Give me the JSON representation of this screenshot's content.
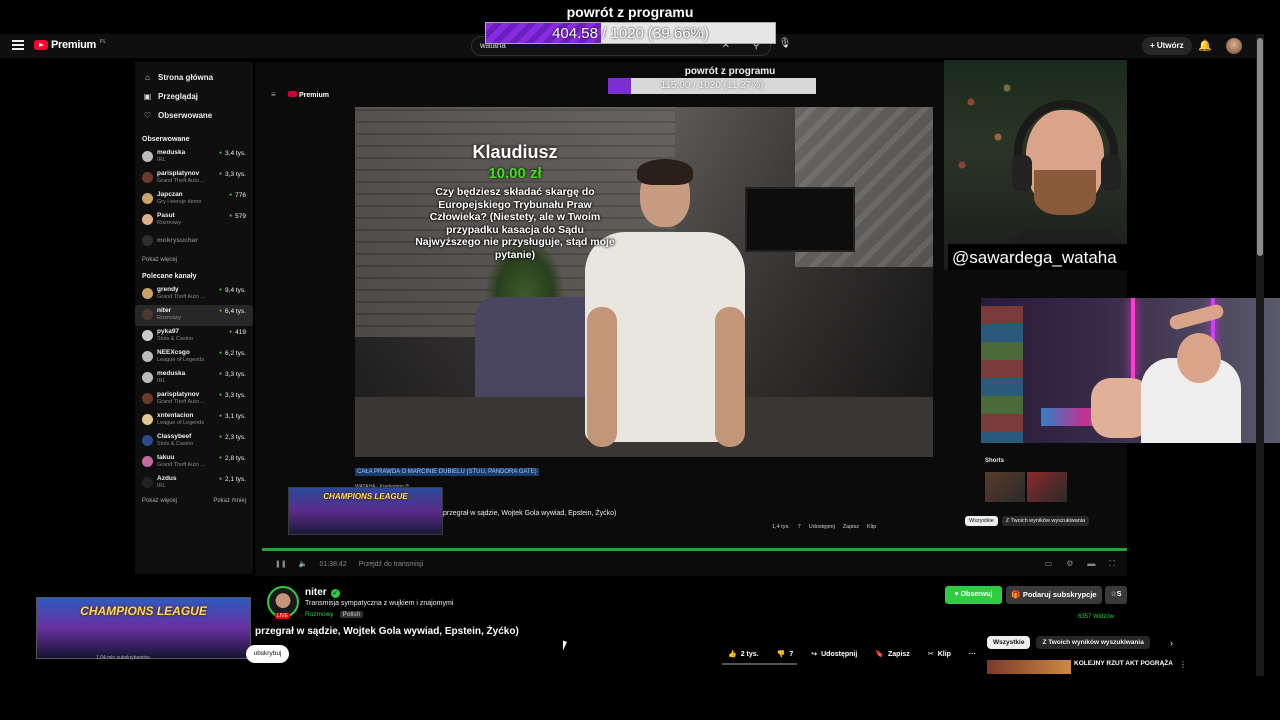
{
  "overlay": {
    "title": "powrót z programu",
    "progress_text": "404.58 / 1020 (39.66%)",
    "progress_fraction": 0.3966
  },
  "header": {
    "logo": "Premium",
    "logo_region": "PL",
    "search_value": "wataha",
    "create_label": "Utwórz"
  },
  "sidebar": {
    "main": [
      {
        "label": "Strona główna",
        "icon": "home-icon"
      },
      {
        "label": "Przeglądaj",
        "icon": "browse-icon"
      },
      {
        "label": "Obserwowane",
        "icon": "heart-icon"
      }
    ],
    "following_header": "Obserwowane",
    "following": [
      {
        "name": "meduska",
        "category": "IRL",
        "viewers": "3,4 tys."
      },
      {
        "name": "parisplatynov",
        "category": "Grand Theft Auto ...",
        "viewers": "3,3 tys."
      },
      {
        "name": "Japczan",
        "category": "Gry i wersje demo",
        "viewers": "776"
      },
      {
        "name": "Pasut",
        "category": "Rozmowy",
        "viewers": "579"
      },
      {
        "name": "mokrysuchar",
        "category": "",
        "viewers": ""
      }
    ],
    "show_more": "Pokaż więcej",
    "recommended_header": "Polecane kanały",
    "recommended": [
      {
        "name": "grendy",
        "category": "Grand Theft Auto ...",
        "viewers": "9,4 tys."
      },
      {
        "name": "niter",
        "category": "Rozmowy",
        "viewers": "6,4 tys."
      },
      {
        "name": "pyka97",
        "category": "Slots & Casino",
        "viewers": "419"
      },
      {
        "name": "NEEXcsgo",
        "category": "League of Legends",
        "viewers": "6,2 tys."
      },
      {
        "name": "meduska",
        "category": "IRL",
        "viewers": "3,3 tys."
      },
      {
        "name": "parisplatynov",
        "category": "Grand Theft Auto ...",
        "viewers": "3,3 tys."
      },
      {
        "name": "xntentacion",
        "category": "League of Legends",
        "viewers": "3,1 tys."
      },
      {
        "name": "Classybeef",
        "category": "Slots & Casino",
        "viewers": "2,3 tys."
      },
      {
        "name": "takuu",
        "category": "Grand Theft Auto ...",
        "viewers": "2,8 tys."
      },
      {
        "name": "Azdus",
        "category": "IRL",
        "viewers": "2,1 tys."
      }
    ],
    "show_more_bottom": "Pokaż więcej",
    "show_less_bottom": "Pokaż mniej"
  },
  "inner": {
    "logo": "Premium",
    "title": "powrót z programu",
    "progress_text": "115.00 / 1020 (11.27%)",
    "progress_fraction": 0.1127,
    "caption": "CAŁA PRAWDA O MARCINIE DUBIELU (STUU, PANDORA GATE)",
    "channel_meta": "WATAHA · Kredestero ®",
    "shorts_label": "Shorts",
    "second_title": "przegrał w sądzie, Wojtek Gola wywiad, Epstein, Żyćko)",
    "second_actions": [
      "1,4 tys.",
      "7",
      "Udostępnij",
      "Zapisz",
      "Klip"
    ],
    "chips": [
      "Wszystkie",
      "Z Twoich wyników wyszukiwania"
    ],
    "champions_small": "CHAMPIONS LEAGUE",
    "time": "01:38:42",
    "skip_live": "Przejdź do transmisji"
  },
  "donation": {
    "name": "Klaudiusz",
    "amount": "10.00 zł",
    "message": "Czy będziesz składać skargę do Europejskiego Trybunału Praw Człowieka? (Niestety, ale w Twoim przypadku kasacja do Sądu Najwyższego nie przysługuje, stąd moje pytanie)"
  },
  "facecam": {
    "name": "@sawardega_wataha"
  },
  "channel": {
    "name": "niter",
    "description": "Transmisja sympatyczna z wujkiem i znajomymi",
    "category": "Rozmowy",
    "language": "Polish",
    "live_tag": "LIVE",
    "follow_label": "Obserwuj",
    "gift_label": "Podaruj subskrypcje",
    "s_label": "S",
    "viewers": "6357 Widzów"
  },
  "video": {
    "champions": "CHAMPIONS LEAGUE",
    "subs_mini": "1,04 mln subskrybentów",
    "subscribe_label": "ubskrybuj",
    "title": "przegrał w sądzie, Wojtek Gola wywiad, Epstein, Żyćko)",
    "likes": "2 tys.",
    "dislikes": "7",
    "share": "Udostępnij",
    "save": "Zapisz",
    "clip": "Klip",
    "more": "···"
  },
  "chips": {
    "all": "Wszystkie",
    "from_search": "Z Twoich wyników wyszukiwania"
  },
  "related": {
    "title": "KOLEJNY RZUT AKT POGRĄŻA"
  }
}
